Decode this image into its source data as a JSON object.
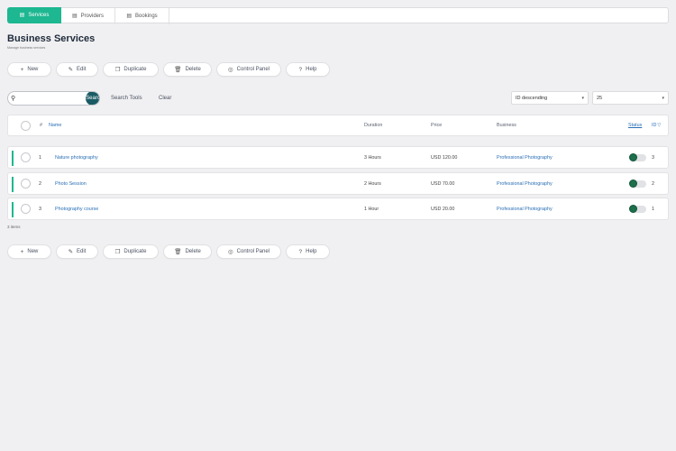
{
  "tabs": [
    {
      "label": "Services",
      "icon": "services-icon",
      "active": true
    },
    {
      "label": "Providers",
      "icon": "providers-icon",
      "active": false
    },
    {
      "label": "Bookings",
      "icon": "bookings-icon",
      "active": false
    }
  ],
  "page": {
    "title": "Business Services",
    "subtitle": "Manage business services"
  },
  "toolbar": {
    "new": "New",
    "edit": "Edit",
    "duplicate": "Duplicate",
    "delete": "Delete",
    "control_panel": "Control Panel",
    "help": "Help"
  },
  "search": {
    "value": "",
    "button": "Search",
    "tools": "Search Tools",
    "clear": "Clear"
  },
  "ordering": {
    "selected": "ID descending"
  },
  "limit": {
    "selected": "25"
  },
  "table": {
    "headers": {
      "num": "#",
      "name": "Name",
      "duration": "Duration",
      "price": "Price",
      "business": "Business",
      "status": "Status",
      "id": "ID"
    },
    "rows": [
      {
        "num": "1",
        "name": "Nature photography",
        "duration": "3 Hours",
        "price": "USD 120.00",
        "business": "Professional Photography",
        "id": "3"
      },
      {
        "num": "2",
        "name": "Photo Session",
        "duration": "2 Hours",
        "price": "USD 70.00",
        "business": "Professional Photography",
        "id": "2"
      },
      {
        "num": "3",
        "name": "Photography course",
        "duration": "1 Hour",
        "price": "USD 20.00",
        "business": "Professional Photography",
        "id": "1"
      }
    ]
  },
  "items_count": "3 items",
  "colors": {
    "accent": "#1db791",
    "search_button": "#1a5a64",
    "link": "#2a6fb5",
    "toggle_on": "#1d6f4a"
  }
}
